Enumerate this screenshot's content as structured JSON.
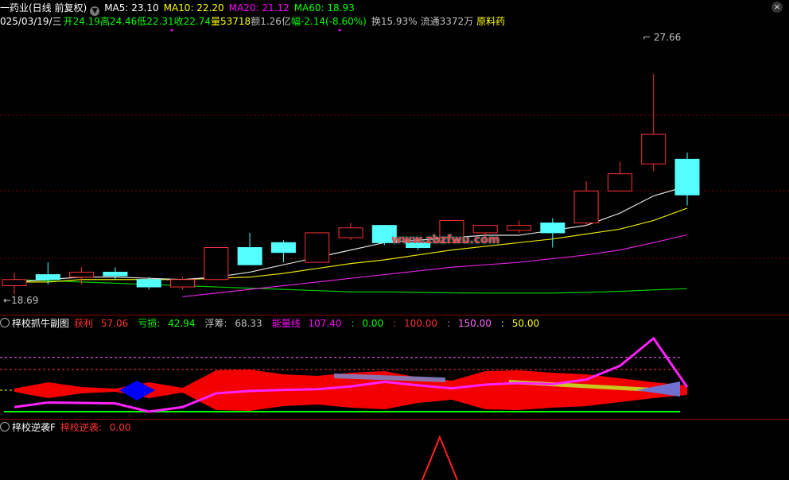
{
  "header": {
    "title": "一药业(日线 前复权)",
    "dropdown_icon": "chevron-down-icon",
    "ma": [
      {
        "label": "MA5: 23.10",
        "color": "#ffffff"
      },
      {
        "label": "MA10: 22.20",
        "color": "#ffff00"
      },
      {
        "label": "MA20: 21.12",
        "color": "#ff00ff"
      },
      {
        "label": "MA60: 18.93",
        "color": "#00ff00"
      }
    ]
  },
  "info_bar": {
    "date": "025/03/19/三",
    "open": "开24.19",
    "high": "高24.46",
    "low": "低22.31",
    "close": "收22.74",
    "volume": "量53718",
    "amount": "额1.26亿",
    "change": "幅-2.14(-8.60%)",
    "turnover": "换15.93%",
    "float": "流通3372万",
    "sector": "原料药"
  },
  "price_labels": {
    "high": "27.66",
    "low": "18.69"
  },
  "watermark": "www.zbzfwu.com",
  "sub1": {
    "name": "梓校抓牛副图",
    "items": [
      {
        "label": "获利",
        "value": "57.06",
        "lcolor": "#ff3030",
        "vcolor": "#ff3030"
      },
      {
        "label": "亏损:",
        "value": "42.94",
        "lcolor": "#00ff00",
        "vcolor": "#00ff00"
      },
      {
        "label": "浮筹:",
        "value": "68.33",
        "lcolor": "#c0c0c0",
        "vcolor": "#c0c0c0"
      },
      {
        "label": "能量线",
        "value": "107.40",
        "lcolor": "#ff00ff",
        "vcolor": "#ff00ff"
      },
      {
        "label": ":",
        "value": "0.00",
        "lcolor": "#00ff00",
        "vcolor": "#00ff00"
      },
      {
        "label": ":",
        "value": "100.00",
        "lcolor": "#ff3030",
        "vcolor": "#ff3030"
      },
      {
        "label": ":",
        "value": "150.00",
        "lcolor": "#ff66ff",
        "vcolor": "#ff66ff"
      },
      {
        "label": ":",
        "value": "50.00",
        "lcolor": "#ffff00",
        "vcolor": "#ffff00"
      }
    ]
  },
  "sub2": {
    "name": "梓校逆袭F",
    "items": [
      {
        "label": "梓校逆袭:",
        "value": "0.00"
      }
    ]
  },
  "chart_data": {
    "type": "candlestick",
    "y_range": [
      18.0,
      29.5
    ],
    "candles": [
      {
        "o": 19.05,
        "c": 19.3,
        "h": 19.6,
        "l": 18.69
      },
      {
        "o": 19.5,
        "c": 19.3,
        "h": 20.0,
        "l": 19.1
      },
      {
        "o": 19.4,
        "c": 19.6,
        "h": 19.8,
        "l": 19.1
      },
      {
        "o": 19.6,
        "c": 19.45,
        "h": 19.8,
        "l": 19.3
      },
      {
        "o": 19.3,
        "c": 19.0,
        "h": 19.4,
        "l": 18.9
      },
      {
        "o": 19.0,
        "c": 19.3,
        "h": 19.4,
        "l": 18.9
      },
      {
        "o": 19.3,
        "c": 20.6,
        "h": 20.6,
        "l": 19.3
      },
      {
        "o": 20.6,
        "c": 19.9,
        "h": 21.2,
        "l": 19.9
      },
      {
        "o": 20.8,
        "c": 20.4,
        "h": 20.9,
        "l": 20.0
      },
      {
        "o": 20.0,
        "c": 21.2,
        "h": 21.2,
        "l": 20.0
      },
      {
        "o": 21.0,
        "c": 21.4,
        "h": 21.6,
        "l": 20.9
      },
      {
        "o": 21.5,
        "c": 20.8,
        "h": 21.5,
        "l": 20.7
      },
      {
        "o": 20.8,
        "c": 20.6,
        "h": 20.9,
        "l": 20.5
      },
      {
        "o": 20.8,
        "c": 21.7,
        "h": 21.7,
        "l": 20.8
      },
      {
        "o": 21.2,
        "c": 21.5,
        "h": 21.5,
        "l": 21.0
      },
      {
        "o": 21.3,
        "c": 21.5,
        "h": 21.7,
        "l": 21.2
      },
      {
        "o": 21.6,
        "c": 21.2,
        "h": 21.8,
        "l": 20.6
      },
      {
        "o": 21.6,
        "c": 22.9,
        "h": 23.3,
        "l": 21.5
      },
      {
        "o": 22.9,
        "c": 23.6,
        "h": 24.1,
        "l": 22.9
      },
      {
        "o": 24.0,
        "c": 25.2,
        "h": 27.66,
        "l": 23.7
      },
      {
        "o": 24.19,
        "c": 22.74,
        "h": 24.46,
        "l": 22.31
      }
    ],
    "ma5": [
      19.2,
      19.3,
      19.4,
      19.4,
      19.35,
      19.3,
      19.4,
      19.6,
      19.9,
      20.2,
      20.5,
      20.8,
      20.9,
      21.0,
      21.1,
      21.1,
      21.3,
      21.5,
      22.0,
      22.7,
      23.1
    ],
    "ma10": [
      19.2,
      19.2,
      19.3,
      19.3,
      19.3,
      19.3,
      19.35,
      19.4,
      19.55,
      19.75,
      19.95,
      20.1,
      20.3,
      20.5,
      20.65,
      20.8,
      20.95,
      21.15,
      21.35,
      21.7,
      22.2
    ],
    "ma20": [
      null,
      null,
      null,
      null,
      null,
      18.6,
      18.75,
      18.9,
      19.05,
      19.2,
      19.35,
      19.5,
      19.65,
      19.8,
      19.9,
      20.0,
      20.15,
      20.3,
      20.5,
      20.8,
      21.12
    ],
    "ma60": [
      19.3,
      19.25,
      19.2,
      19.15,
      19.1,
      19.05,
      19.0,
      18.95,
      18.9,
      18.85,
      18.8,
      18.8,
      18.78,
      18.76,
      18.75,
      18.75,
      18.75,
      18.78,
      18.82,
      18.88,
      18.93
    ],
    "sub1_energy": [
      20,
      40,
      38,
      36,
      0,
      20,
      80,
      90,
      95,
      98,
      110,
      130,
      115,
      102,
      118,
      125,
      120,
      140,
      200,
      320,
      107
    ],
    "sub1_levels": {
      "zero": 0,
      "fifty": 50,
      "hundred": 100,
      "one_fifty": 150
    },
    "sub2_signal": [
      0,
      0,
      0,
      0,
      0,
      0,
      0,
      0,
      0,
      0,
      0,
      0,
      0,
      1,
      0,
      0,
      0,
      0,
      0,
      0,
      0
    ]
  }
}
